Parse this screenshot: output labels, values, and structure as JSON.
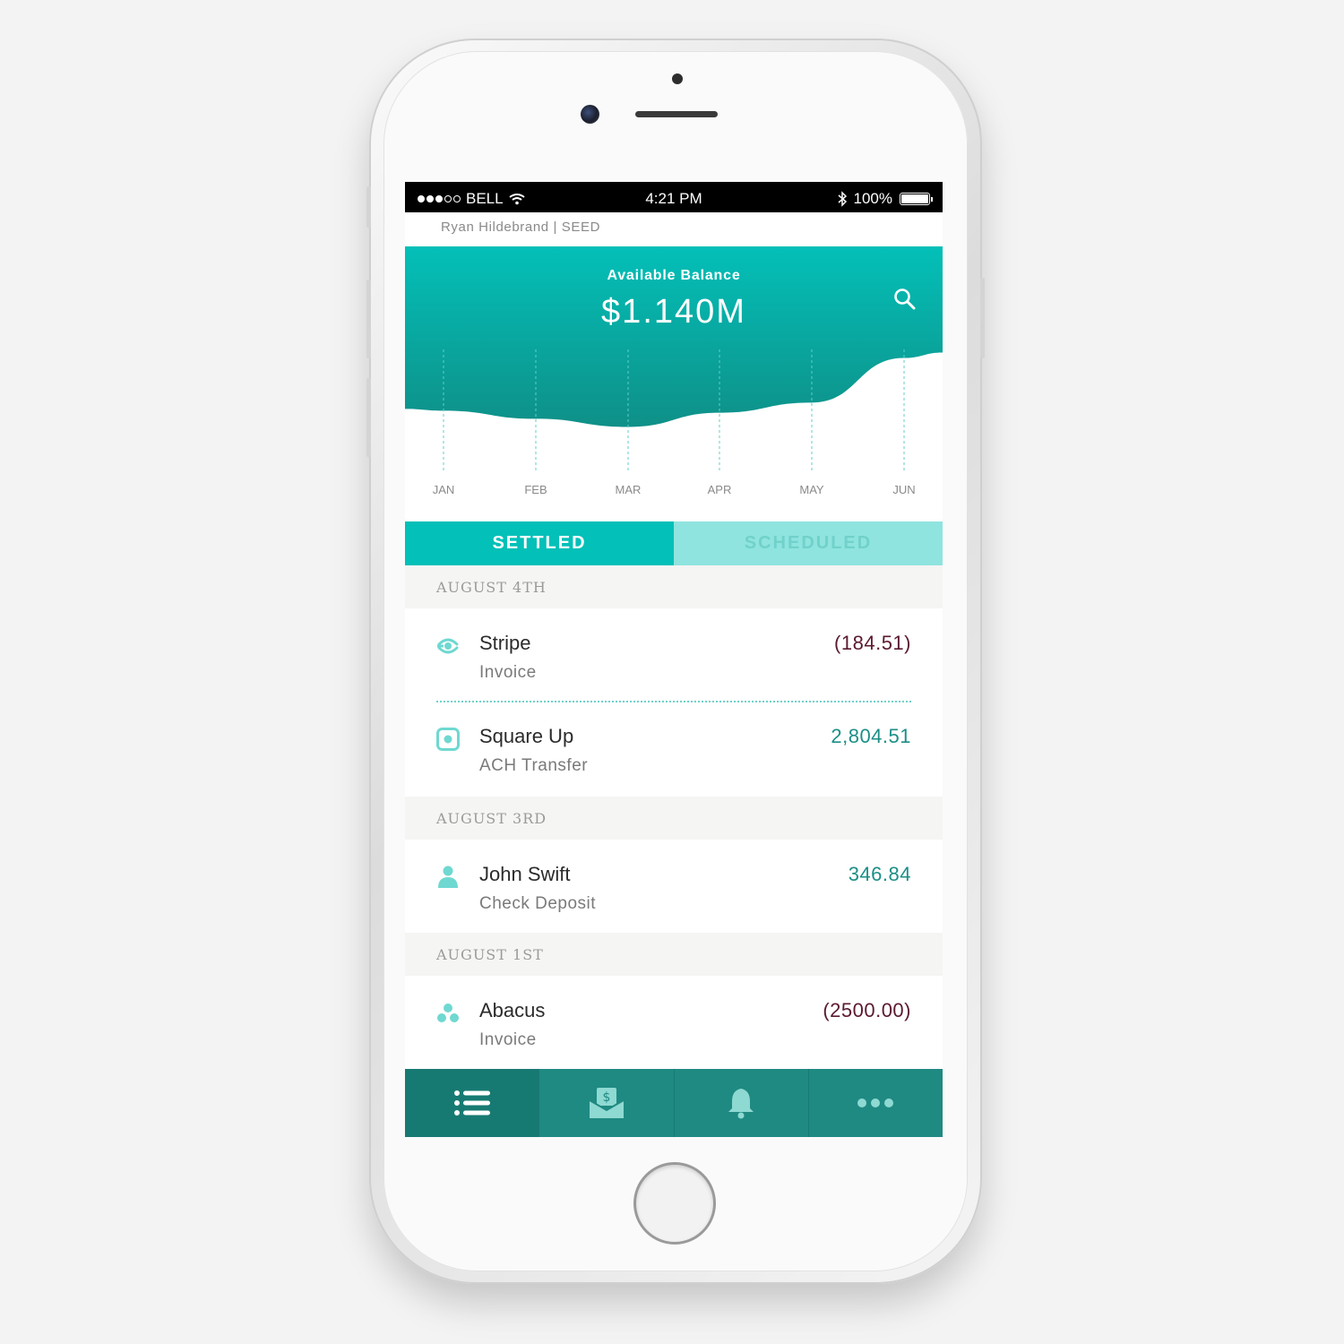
{
  "status_bar": {
    "carrier": "BELL",
    "time": "4:21 PM",
    "battery": "100%",
    "signal_bars_filled": 3,
    "signal_bars_total": 5
  },
  "user": {
    "label": "Ryan Hildebrand | SEED"
  },
  "balance": {
    "label": "Available Balance",
    "value": "$1.140M"
  },
  "chart_data": {
    "type": "area",
    "categories": [
      "JAN",
      "FEB",
      "MAR",
      "APR",
      "MAY",
      "JUN"
    ],
    "values": [
      0.88,
      0.84,
      0.8,
      0.87,
      0.92,
      1.14
    ],
    "title": "",
    "xlabel": "",
    "ylabel": "",
    "grid": "dashed vertical",
    "colors": {
      "top": "#03c0b8",
      "bottom": "#0e9088",
      "grid": "#5fcfc8",
      "tick": "#8a8a8a"
    }
  },
  "tabs": [
    {
      "label": "SETTLED",
      "active": true
    },
    {
      "label": "SCHEDULED",
      "active": false
    }
  ],
  "groups": [
    {
      "date": "AUGUST 4TH",
      "transactions": [
        {
          "name": "Stripe",
          "type": "Invoice",
          "amount": "(184.51)",
          "direction": "negative",
          "icon": "stripe-icon"
        },
        {
          "name": "Square Up",
          "type": "ACH Transfer",
          "amount": "2,804.51",
          "direction": "positive",
          "icon": "square-icon"
        }
      ]
    },
    {
      "date": "AUGUST 3RD",
      "transactions": [
        {
          "name": "John Swift",
          "type": "Check Deposit",
          "amount": "346.84",
          "direction": "positive",
          "icon": "person-icon"
        }
      ]
    },
    {
      "date": "AUGUST 1ST",
      "transactions": [
        {
          "name": "Abacus",
          "type": "Invoice",
          "amount": "(2500.00)",
          "direction": "negative",
          "icon": "abacus-icon"
        }
      ]
    }
  ],
  "bottom_nav": [
    {
      "icon": "list-icon",
      "active": true
    },
    {
      "icon": "deposit-icon",
      "active": false
    },
    {
      "icon": "bell-icon",
      "active": false
    },
    {
      "icon": "more-icon",
      "active": false
    }
  ],
  "colors": {
    "accent": "#03c0b8",
    "accent_dark": "#1f8a82",
    "negative": "#5b1932",
    "positive": "#1b8f87"
  }
}
